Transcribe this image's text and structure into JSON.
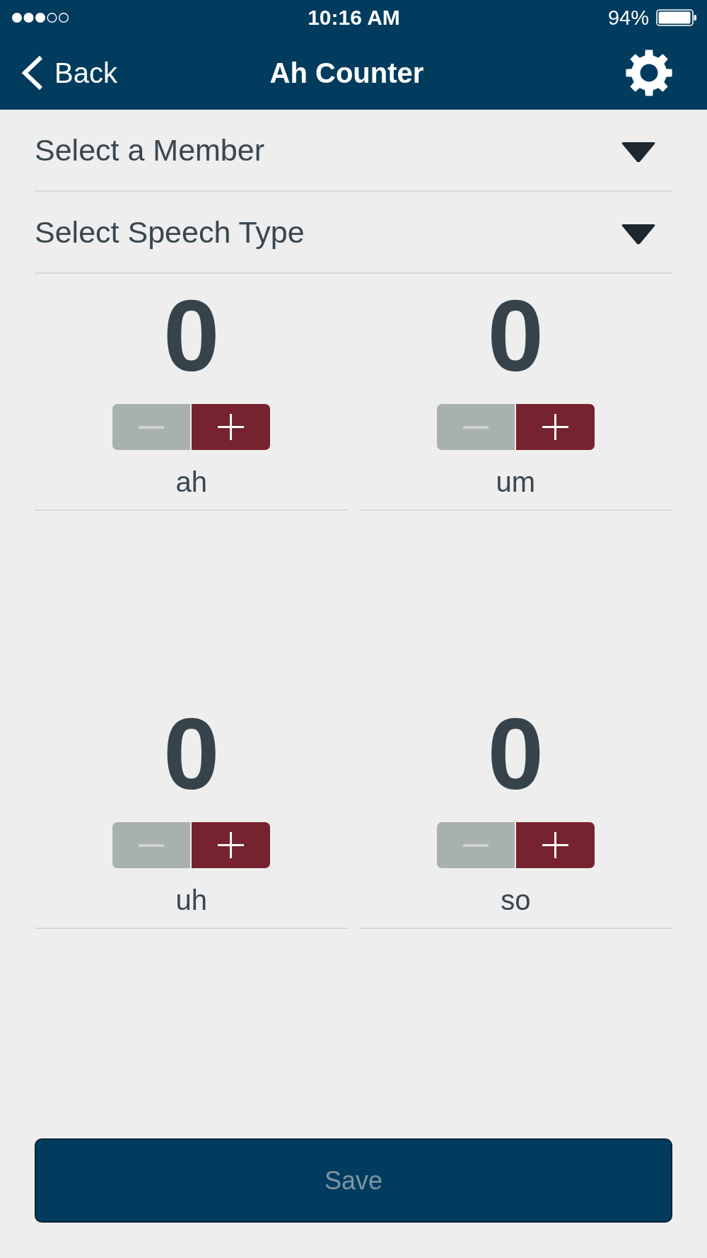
{
  "status_bar": {
    "time": "10:16 AM",
    "battery": "94%"
  },
  "nav_bar": {
    "back": "Back",
    "title": "Ah Counter"
  },
  "selects": [
    {
      "placeholder": "Select a Member"
    },
    {
      "placeholder": "Select Speech Type"
    }
  ],
  "counters": [
    {
      "value": "0",
      "label": "ah",
      "decrement_disabled": true
    },
    {
      "value": "0",
      "label": "um",
      "decrement_disabled": true
    },
    {
      "value": "0",
      "label": "uh",
      "decrement_disabled": true
    },
    {
      "value": "0",
      "label": "so",
      "decrement_disabled": true
    }
  ],
  "save_button": {
    "label": "Save",
    "disabled": true
  }
}
